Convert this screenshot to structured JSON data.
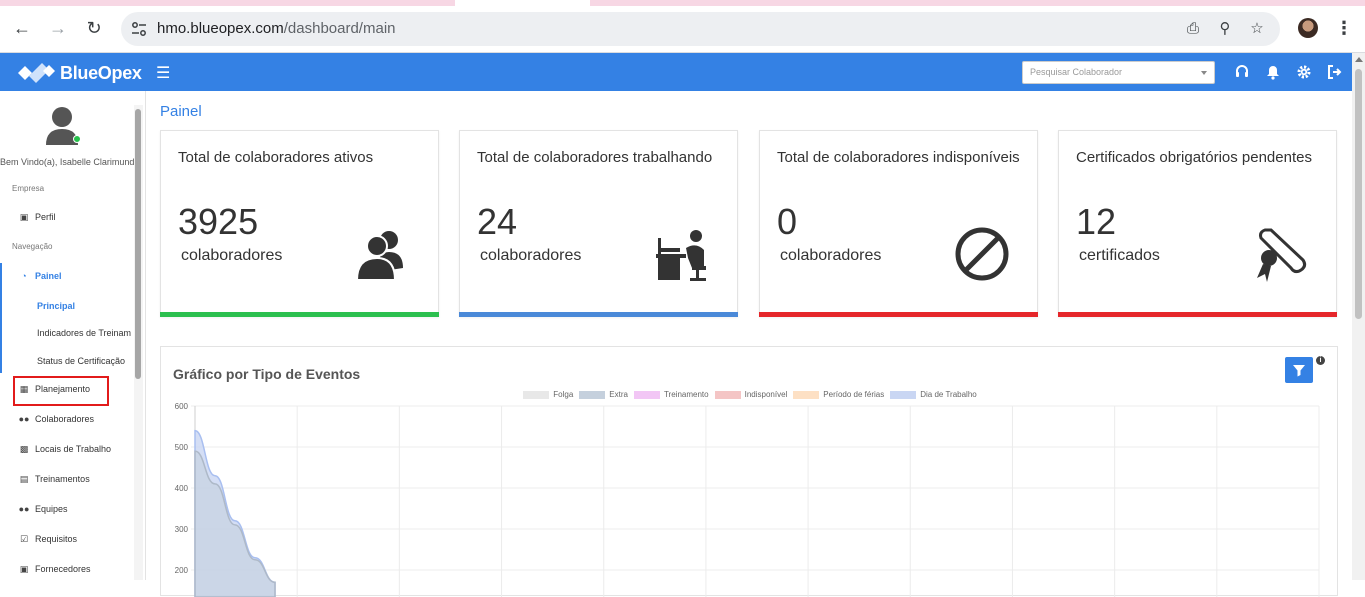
{
  "browser": {
    "url_host": "hmo.blueopex.com",
    "url_path": "/dashboard/main"
  },
  "app": {
    "brand": "BlueOpex",
    "search_placeholder": "Pesquisar Colaborador"
  },
  "sidebar": {
    "welcome": "Bem Vindo(a), Isabelle Clarimundo",
    "section_empresa": "Empresa",
    "section_navegacao": "Navegação",
    "items": [
      {
        "label": "Perfil",
        "icon": "briefcase-icon"
      },
      {
        "label": "Painel",
        "icon": "dashboard-icon"
      },
      {
        "label": "Planejamento",
        "icon": "calendar-icon"
      },
      {
        "label": "Colaboradores",
        "icon": "users-icon"
      },
      {
        "label": "Locais de Trabalho",
        "icon": "building-icon"
      },
      {
        "label": "Treinamentos",
        "icon": "chalkboard-icon"
      },
      {
        "label": "Equipes",
        "icon": "team-icon"
      },
      {
        "label": "Requisitos",
        "icon": "checkbox-icon"
      },
      {
        "label": "Fornecedores",
        "icon": "briefcase-icon"
      }
    ],
    "subitems": [
      {
        "label": "Principal"
      },
      {
        "label": "Indicadores de Treinam"
      },
      {
        "label": "Status de Certificação"
      }
    ]
  },
  "main": {
    "page_title": "Painel",
    "cards": [
      {
        "title": "Total de colaboradores ativos",
        "value": "3925",
        "unit": "colaboradores",
        "color": "#2bbf4e"
      },
      {
        "title": "Total de colaboradores trabalhando",
        "value": "24",
        "unit": "colaboradores",
        "color": "#4a89d8"
      },
      {
        "title": "Total de colaboradores indisponíveis",
        "value": "0",
        "unit": "colaboradores",
        "color": "#e5262a"
      },
      {
        "title": "Certificados obrigatórios pendentes",
        "value": "12",
        "unit": "certificados",
        "color": "#e5262a"
      }
    ]
  },
  "chart_data": {
    "type": "area",
    "title": "Gráfico por Tipo de Eventos",
    "series": [
      {
        "name": "Folga",
        "color": "#e8e8e8"
      },
      {
        "name": "Extra",
        "color": "#c5d0dd"
      },
      {
        "name": "Treinamento",
        "color": "#f2c6f5"
      },
      {
        "name": "Indisponível",
        "color": "#f4c5c5"
      },
      {
        "name": "Período de férias",
        "color": "#fde0c4"
      },
      {
        "name": "Dia de Trabalho",
        "color": "#c9d6f3"
      }
    ],
    "y_ticks": [
      "600",
      "500",
      "400",
      "300",
      "200"
    ],
    "ylim": [
      200,
      600
    ],
    "visible_curves": [
      {
        "series": "Dia de Trabalho",
        "y": [
          540,
          430,
          320,
          230,
          170
        ]
      },
      {
        "series": "Extra",
        "y": [
          490,
          410,
          310,
          225,
          170
        ]
      }
    ]
  }
}
